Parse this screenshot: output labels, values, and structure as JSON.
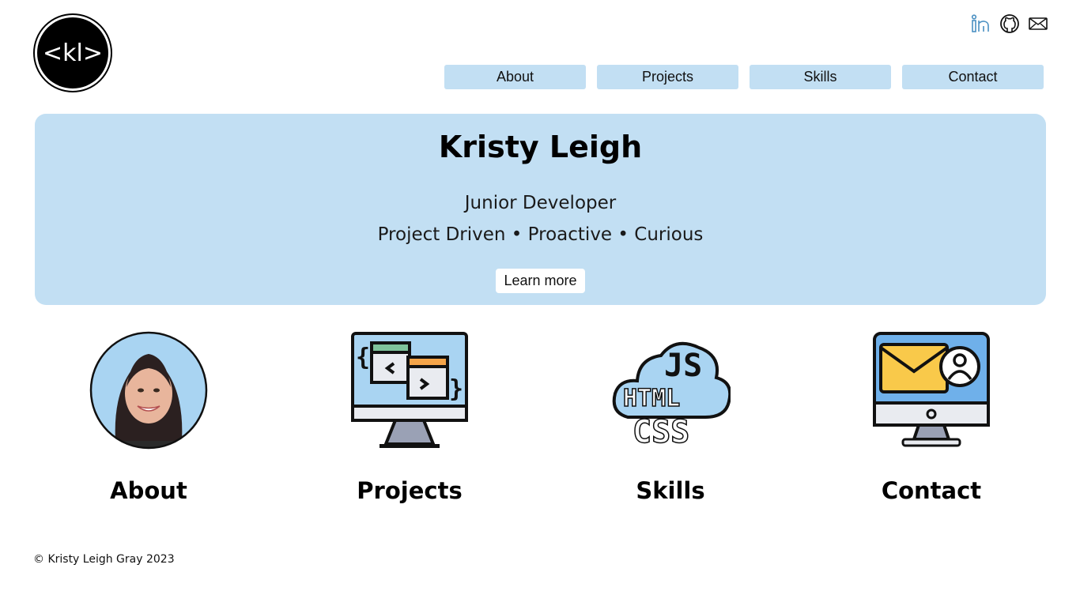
{
  "logo": {
    "text": "<kl>"
  },
  "social": [
    {
      "name": "linkedin-icon",
      "color": "#4a90c2"
    },
    {
      "name": "github-icon",
      "color": "#111111"
    },
    {
      "name": "mail-icon",
      "color": "#111111"
    }
  ],
  "nav": {
    "items": [
      "About",
      "Projects",
      "Skills",
      "Contact"
    ]
  },
  "hero": {
    "title": "Kristy Leigh",
    "subtitle": "Junior Developer",
    "tags": "Project Driven • Proactive • Curious",
    "button_label": "Learn more"
  },
  "cards": [
    {
      "title": "About",
      "icon": "profile-photo"
    },
    {
      "title": "Projects",
      "icon": "monitor-code-icon"
    },
    {
      "title": "Skills",
      "icon": "cloud-js-html-css-icon"
    },
    {
      "title": "Contact",
      "icon": "monitor-mail-icon"
    }
  ],
  "colors": {
    "accent": "#c2dff3",
    "text": "#111111",
    "linkedin": "#4a90c2"
  },
  "footer": {
    "text": "© Kristy Leigh Gray 2023"
  }
}
